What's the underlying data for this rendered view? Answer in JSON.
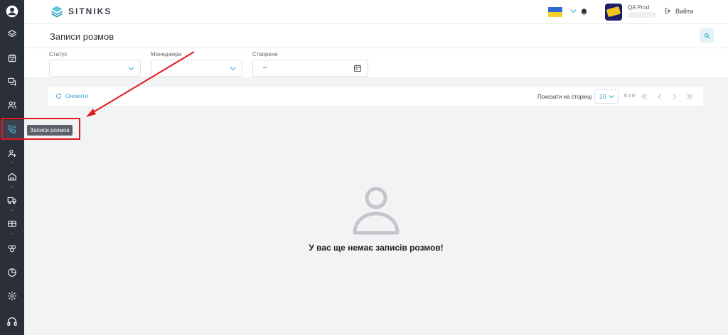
{
  "brand": {
    "name": "SITNIKS",
    "accent": "#4fb8d6"
  },
  "sidebar": {
    "items": [
      {
        "name": "avatar-icon"
      },
      {
        "name": "layers-icon"
      },
      {
        "name": "calendar-icon"
      },
      {
        "name": "chat-icon"
      },
      {
        "name": "users-icon"
      },
      {
        "name": "phone-icon",
        "active": true,
        "tooltip": "Записи розмов"
      },
      {
        "name": "user-plus-icon"
      },
      {
        "name": "home-icon"
      },
      {
        "name": "truck-icon"
      },
      {
        "name": "wallet-icon"
      },
      {
        "name": "link-icon"
      },
      {
        "name": "pie-chart-icon"
      },
      {
        "name": "settings-icon"
      },
      {
        "name": "headset-icon"
      }
    ]
  },
  "header": {
    "language_flag": "ua",
    "user_name": "QA Prod",
    "logout_label": "Вийти"
  },
  "page": {
    "title": "Записи розмов"
  },
  "filters": {
    "status_label": "Статус",
    "managers_label": "Менеджери",
    "created_label": "Створено",
    "created_value": "–"
  },
  "toolbar": {
    "refresh_label": "Оновити",
    "per_page_label": "Показати на сторінці",
    "per_page_value": "10",
    "range_text": "0 з 0"
  },
  "empty_state": {
    "message": "У вас ще немає записів розмов!"
  },
  "annotation": {
    "tooltip_text": "Записи розмов",
    "color": "#e0191d"
  }
}
